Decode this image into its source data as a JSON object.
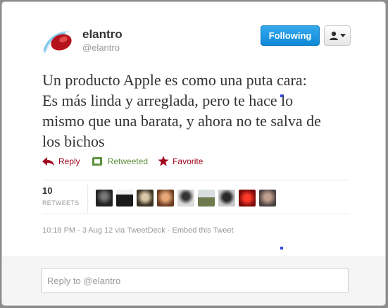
{
  "user": {
    "name": "elantro",
    "handle": "@elantro"
  },
  "buttons": {
    "follow_label": "Following"
  },
  "tweet": {
    "text": "Un producto Apple es como una puta cara:\nEs más linda y arreglada, pero te hace lo\nmismo que una barata, y ahora no te salva de\nlos bichos"
  },
  "actions": {
    "reply": "Reply",
    "retweeted": "Retweeted",
    "favorite": "Favorite"
  },
  "stats": {
    "count": "10",
    "label": "RETWEETS"
  },
  "meta": {
    "timestamp": "10:18 PM - 3 Aug 12",
    "via": "via TweetDeck",
    "separator": "·",
    "embed": "Embed this Tweet"
  },
  "reply_box": {
    "placeholder": "Reply to @elantro"
  },
  "colors": {
    "follow_button": "#1b93e0",
    "reply": "#a0041e",
    "retweeted": "#5c913b",
    "favorite": "#a0041e"
  }
}
